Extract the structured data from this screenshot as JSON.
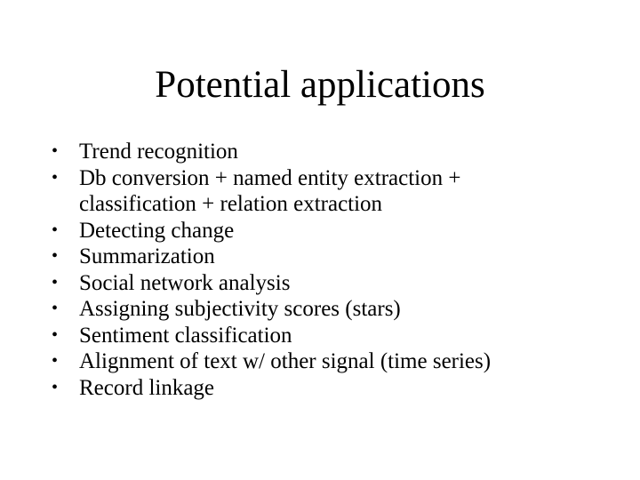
{
  "slide": {
    "title": "Potential applications",
    "bullet_glyph": "•",
    "bullets": [
      {
        "text": "Trend recognition"
      },
      {
        "text": "Db conversion + named entity extraction + classification + relation extraction"
      },
      {
        "text": "Detecting change"
      },
      {
        "text": "Summarization"
      },
      {
        "text": "Social network analysis"
      },
      {
        "text": "Assigning subjectivity scores (stars)"
      },
      {
        "text": "Sentiment classification"
      },
      {
        "text": "Alignment of text w/ other signal (time series)"
      },
      {
        "text": "Record linkage"
      }
    ]
  }
}
